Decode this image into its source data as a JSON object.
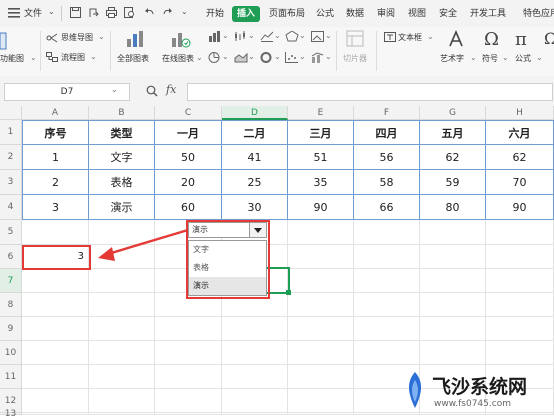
{
  "menubar": {
    "file_label": "文件",
    "tabs": [
      "开始",
      "插入",
      "页面布局",
      "公式",
      "数据",
      "审阅",
      "视图",
      "安全",
      "开发工具",
      "特色应用"
    ],
    "active_tab": "插入"
  },
  "ribbon": {
    "left_cut_label": "功能图",
    "mindmap_label": "思维导图",
    "flowchart_label": "流程图",
    "all_charts_label": "全部图表",
    "online_charts_label": "在线图表",
    "slicer_label": "切片器",
    "textbox_label": "文本框",
    "wordart_label": "艺术字",
    "symbol_label": "符号",
    "formula_label": "公式"
  },
  "formula_bar": {
    "name_box": "D7",
    "fx_label": "fx",
    "content": ""
  },
  "sheet": {
    "col_headers": [
      "A",
      "B",
      "C",
      "D",
      "E",
      "F",
      "G",
      "H"
    ],
    "selected_col": "D",
    "row_headers": [
      "1",
      "2",
      "3",
      "4",
      "5",
      "6",
      "7",
      "8",
      "9",
      "10",
      "11",
      "12",
      "13"
    ],
    "selected_row": "7",
    "table_header": [
      "序号",
      "类型",
      "一月",
      "二月",
      "三月",
      "四月",
      "五月",
      "六月"
    ],
    "table_rows": [
      [
        "1",
        "文字",
        "50",
        "41",
        "51",
        "56",
        "62",
        "62"
      ],
      [
        "2",
        "表格",
        "20",
        "25",
        "35",
        "58",
        "59",
        "70"
      ],
      [
        "3",
        "演示",
        "60",
        "30",
        "90",
        "66",
        "80",
        "90"
      ]
    ],
    "a6_value": "3"
  },
  "dropdown": {
    "current_value": "演示",
    "options": [
      "文字",
      "表格",
      "演示"
    ],
    "highlighted": "演示"
  },
  "watermark": {
    "brand": "飞沙系统网",
    "url": "www.fs0745.com"
  },
  "colors": {
    "accent_green": "#1f9d55",
    "highlight_red": "#e53935",
    "table_border_blue": "#6f9fd2"
  }
}
